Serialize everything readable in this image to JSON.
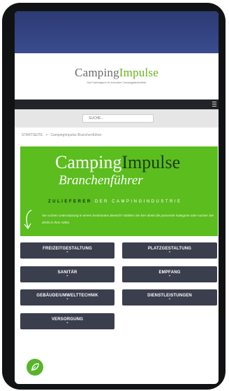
{
  "header": {
    "logo_part1": "Camping",
    "logo_part2": "Impulse",
    "tagline": "Das Fachmagazin für innovative Campingplatzbetriebe"
  },
  "search": {
    "placeholder": "SUCHE..."
  },
  "breadcrumb": {
    "home": "STARTSEITE",
    "separator": ">",
    "current": "CampingImpulse Branchenführer"
  },
  "banner": {
    "title_part1": "Camping",
    "title_part2": "Impulse",
    "subtitle": "Branchenführer",
    "tag_bold": "ZULIEFERER",
    "tag_rest": "DER CAMPINGINDUSTRIE",
    "description": "Sie suchen Unterstützung in einem bestimmten Bereich? Wählen Sie hier direkt die passende Kategorie oder suchen Sie direkt in Ihrer Nähe."
  },
  "categories": [
    {
      "label": "FREIZEITGESTALTUNG"
    },
    {
      "label": "PLATZGESTALTUNG"
    },
    {
      "label": "SANITÄR"
    },
    {
      "label": "EMPFANG"
    },
    {
      "label": "GEBÄUDE/UMWELTTECHNIK"
    },
    {
      "label": "DIENSTLEISTUNGEN"
    },
    {
      "label": "VERSORGUNG"
    }
  ],
  "icons": {
    "menu": "hamburger-menu-icon",
    "arrow": "curved-arrow-down-icon",
    "chevron": "chevron-down-icon",
    "fab": "leaf-icon"
  },
  "colors": {
    "brand_green": "#5bbd1e",
    "header_blue": "#2c3a74",
    "button_dark": "#3b3e4d",
    "navbar": "#232427"
  }
}
